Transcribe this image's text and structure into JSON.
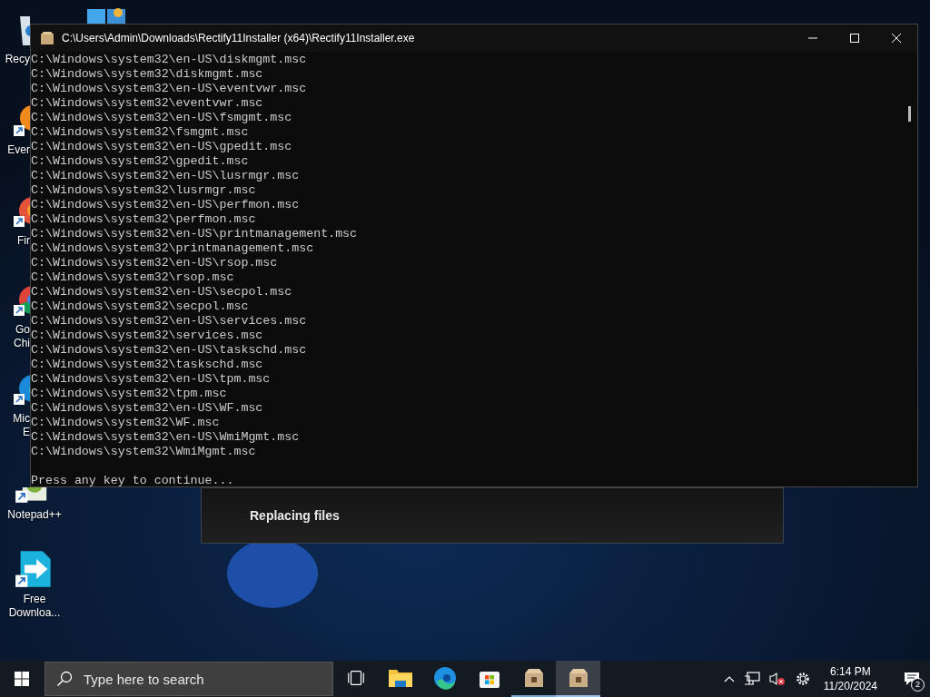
{
  "desktop_icons": [
    {
      "kind": "recycle",
      "label": [
        "Recy"
      ],
      "covered": true
    },
    {
      "kind": "evernote",
      "label": [
        "Ever"
      ],
      "covered": true
    },
    {
      "kind": "firefox",
      "label": [
        "Fir"
      ],
      "covered": true
    },
    {
      "kind": "chrome",
      "label": [
        "Go",
        "Chi"
      ],
      "covered": true
    },
    {
      "kind": "edge",
      "label": [
        "Mic",
        "E"
      ],
      "covered": true
    },
    {
      "kind": "notepad",
      "label": [
        "Notepad++"
      ],
      "covered": false
    },
    {
      "kind": "download",
      "label": [
        "Free",
        "Downloa..."
      ],
      "covered": false
    }
  ],
  "installer": {
    "status": "Replacing files"
  },
  "console": {
    "title": "C:\\Users\\Admin\\Downloads\\Rectify11Installer (x64)\\Rectify11Installer.exe",
    "lines": [
      "C:\\Windows\\system32\\en-US\\diskmgmt.msc",
      "C:\\Windows\\system32\\diskmgmt.msc",
      "C:\\Windows\\system32\\en-US\\eventvwr.msc",
      "C:\\Windows\\system32\\eventvwr.msc",
      "C:\\Windows\\system32\\en-US\\fsmgmt.msc",
      "C:\\Windows\\system32\\fsmgmt.msc",
      "C:\\Windows\\system32\\en-US\\gpedit.msc",
      "C:\\Windows\\system32\\gpedit.msc",
      "C:\\Windows\\system32\\en-US\\lusrmgr.msc",
      "C:\\Windows\\system32\\lusrmgr.msc",
      "C:\\Windows\\system32\\en-US\\perfmon.msc",
      "C:\\Windows\\system32\\perfmon.msc",
      "C:\\Windows\\system32\\en-US\\printmanagement.msc",
      "C:\\Windows\\system32\\printmanagement.msc",
      "C:\\Windows\\system32\\en-US\\rsop.msc",
      "C:\\Windows\\system32\\rsop.msc",
      "C:\\Windows\\system32\\en-US\\secpol.msc",
      "C:\\Windows\\system32\\secpol.msc",
      "C:\\Windows\\system32\\en-US\\services.msc",
      "C:\\Windows\\system32\\services.msc",
      "C:\\Windows\\system32\\en-US\\taskschd.msc",
      "C:\\Windows\\system32\\taskschd.msc",
      "C:\\Windows\\system32\\en-US\\tpm.msc",
      "C:\\Windows\\system32\\tpm.msc",
      "C:\\Windows\\system32\\en-US\\WF.msc",
      "C:\\Windows\\system32\\WF.msc",
      "C:\\Windows\\system32\\en-US\\WmiMgmt.msc",
      "C:\\Windows\\system32\\WmiMgmt.msc"
    ],
    "prompt": "Press any key to continue..."
  },
  "taskbar": {
    "search_placeholder": "Type here to search",
    "apps": [
      {
        "kind": "taskview",
        "running": false,
        "selected": false
      },
      {
        "kind": "explorer",
        "running": false,
        "selected": false
      },
      {
        "kind": "edge",
        "running": false,
        "selected": false
      },
      {
        "kind": "store",
        "running": false,
        "selected": false
      },
      {
        "kind": "package",
        "running": true,
        "selected": false
      },
      {
        "kind": "package",
        "running": true,
        "selected": true
      }
    ],
    "volume_muted": true,
    "time": "6:14 PM",
    "date": "11/20/2024",
    "notifications": "2"
  }
}
